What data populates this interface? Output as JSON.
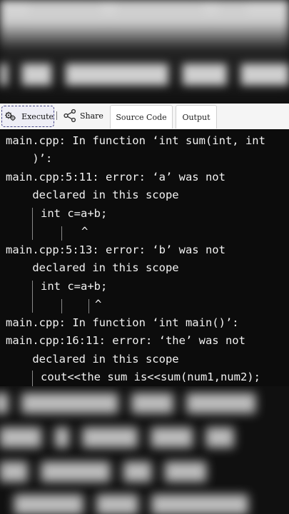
{
  "toolbar": {
    "execute_label": "Execute",
    "share_label": "Share",
    "tabs": [
      {
        "label": "Source Code"
      },
      {
        "label": "Output"
      }
    ]
  },
  "output": {
    "lines": [
      "main.cpp: In function ‘int sum(int, int",
      "    )’:",
      "main.cpp:5:11: error: ‘a’ was not",
      "    declared in this scope",
      "int c=a+b;",
      "^",
      "main.cpp:5:13: error: ‘b’ was not",
      "    declared in this scope",
      "int c=a+b;",
      "^",
      "main.cpp: In function ‘int main()’:",
      "main.cpp:16:11: error: ‘the’ was not",
      "    declared in this scope",
      "cout<<the sum is<<sum(num1,num2);"
    ]
  },
  "colors": {
    "terminal_bg": "#0c0c0c",
    "terminal_text": "#f2f2f2",
    "toolbar_bg": "#f5f5f5"
  }
}
